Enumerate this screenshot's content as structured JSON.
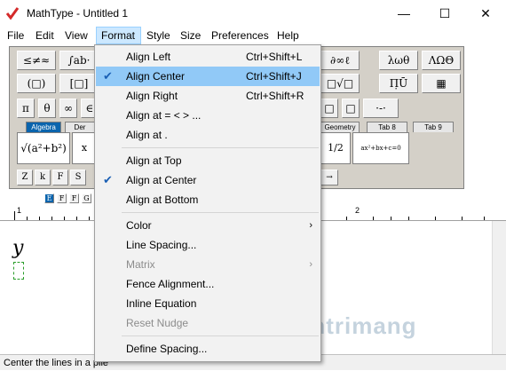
{
  "window": {
    "title": "MathType - Untitled 1",
    "minimize": "—",
    "maximize": "☐",
    "close": "✕"
  },
  "menubar": [
    "File",
    "Edit",
    "View",
    "Format",
    "Style",
    "Size",
    "Preferences",
    "Help"
  ],
  "palette": {
    "row1": [
      "≤≠≈",
      "∫ab·",
      "∂∞ℓ",
      "λωθ",
      "ΛΩΘ"
    ],
    "row2": [
      "(□)",
      "[□]",
      "□√□",
      "Π̣Ū",
      "▦"
    ],
    "row3": [
      "π",
      "θ",
      "∞",
      "∈"
    ],
    "row3_right": [
      "□",
      "□",
      "·-·"
    ],
    "tabs": [
      "Algebra",
      "Der",
      "Geometry",
      "Tab 8",
      "Tab 9"
    ],
    "templates": [
      "√(a²+b²)",
      "x",
      "1/2",
      "ax²+bx+c=0"
    ],
    "row5": [
      "Z",
      "k",
      "F",
      "S",
      "→"
    ],
    "formats": [
      "E",
      "F",
      "F",
      "G"
    ]
  },
  "format_menu": {
    "items": [
      {
        "label": "Align Left",
        "shortcut": "Ctrl+Shift+L"
      },
      {
        "label": "Align Center",
        "shortcut": "Ctrl+Shift+J",
        "checked": true,
        "highlighted": true
      },
      {
        "label": "Align Right",
        "shortcut": "Ctrl+Shift+R"
      },
      {
        "label": "Align at = < > ..."
      },
      {
        "label": "Align at ."
      },
      {
        "label": "Align at Top"
      },
      {
        "label": "Align at Center",
        "checked": true
      },
      {
        "label": "Align at Bottom"
      },
      {
        "label": "Color",
        "submenu": true
      },
      {
        "label": "Line Spacing..."
      },
      {
        "label": "Matrix",
        "submenu": true,
        "disabled": true
      },
      {
        "label": "Fence Alignment..."
      },
      {
        "label": "Inline Equation"
      },
      {
        "label": "Reset Nudge",
        "disabled": true
      },
      {
        "label": "Define Spacing..."
      }
    ]
  },
  "ruler": {
    "mark1": "1",
    "mark2": "2"
  },
  "editor": {
    "content": "y"
  },
  "status": "Center the lines in a pile",
  "watermark": "uantrimang",
  "colors": {
    "highlight": "#91c9f7",
    "tab_selected": "#0a64ad",
    "app_icon": "#d42a2a"
  }
}
